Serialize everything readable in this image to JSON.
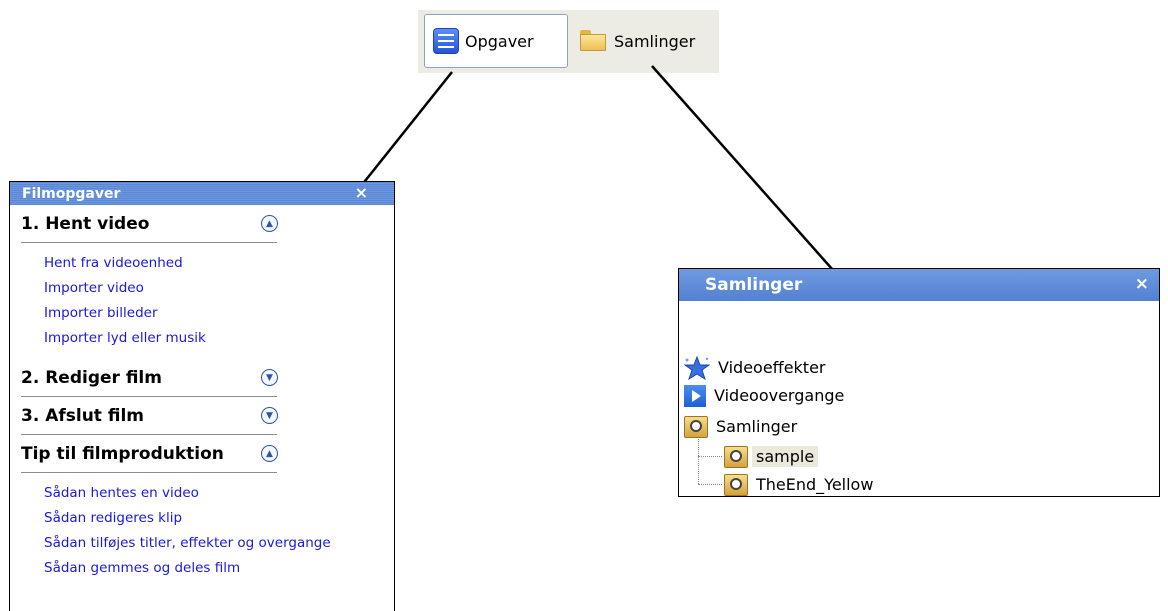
{
  "toolbar": {
    "tasks_label": "Opgaver",
    "collections_label": "Samlinger"
  },
  "taskpane": {
    "title": "Filmopgaver",
    "close": "×",
    "sections": [
      {
        "title": "1. Hent video",
        "expanded": true,
        "links": [
          "Hent fra videoenhed",
          "Importer video",
          "Importer billeder",
          "Importer lyd eller musik"
        ]
      },
      {
        "title": "2. Rediger film",
        "expanded": false,
        "links": []
      },
      {
        "title": "3. Afslut film",
        "expanded": false,
        "links": []
      },
      {
        "title": "Tip til filmproduktion",
        "expanded": true,
        "links": [
          "Sådan hentes en video",
          "Sådan redigeres klip",
          "Sådan tilføjes titler, effekter og overgange",
          "Sådan gemmes og deles film"
        ]
      }
    ]
  },
  "collections_pane": {
    "title": "Samlinger",
    "close": "×",
    "items": [
      {
        "label": "Videoeffekter",
        "icon": "star-icon",
        "level": 0
      },
      {
        "label": "Videoovergange",
        "icon": "transition-icon",
        "level": 0
      },
      {
        "label": "Samlinger",
        "icon": "collection-reel-icon",
        "level": 0
      },
      {
        "label": "sample",
        "icon": "collection-reel-icon",
        "level": 1,
        "selected": true
      },
      {
        "label": "TheEnd_Yellow",
        "icon": "collection-reel-icon",
        "level": 1
      }
    ]
  },
  "colors": {
    "title_bar": "#5b88d6",
    "link": "#1a19d8",
    "toolbar_bg": "#ecebe4"
  }
}
